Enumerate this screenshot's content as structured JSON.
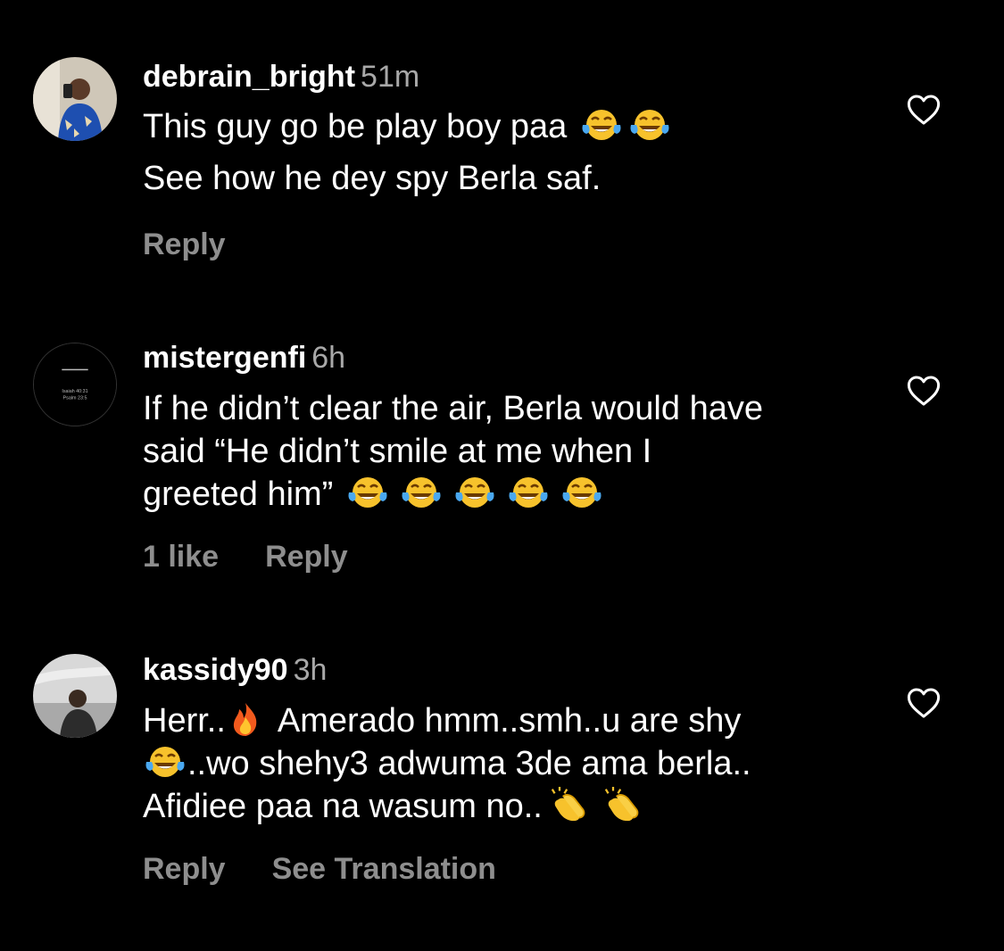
{
  "comments": [
    {
      "username": "debrain_bright",
      "time": "51m",
      "lines": [
        "This guy go be play boy paa",
        "See how he dey spy Berla saf."
      ],
      "likes": "",
      "reply": "Reply",
      "translation": ""
    },
    {
      "username": "mistergenfi",
      "time": "6h",
      "lines": [
        "If he didn’t clear the air, Berla would have",
        "said “He didn’t smile at me when I",
        "greeted him”"
      ],
      "likes": "1 like",
      "reply": "Reply",
      "translation": "",
      "avatar_text": [
        "Isaiah 40:31",
        "Psalm 23:5"
      ]
    },
    {
      "username": "kassidy90",
      "time": "3h",
      "lines": [
        "Herr..",
        "Amerado hmm..smh..u are shy",
        "..wo shehy3 adwuma 3de ama berla..",
        "Afidiee paa na wasum no.."
      ],
      "likes": "",
      "reply": "Reply",
      "translation": "See Translation"
    }
  ],
  "icons": {
    "laugh": "face-with-tears-of-joy-icon",
    "fire": "fire-icon",
    "clap": "clapping-hands-icon",
    "heart": "heart-outline-icon"
  },
  "colors": {
    "background": "#000000",
    "text": "#ffffff",
    "muted": "#8e8e8e",
    "emoji_yellow": "#f7c22c"
  }
}
